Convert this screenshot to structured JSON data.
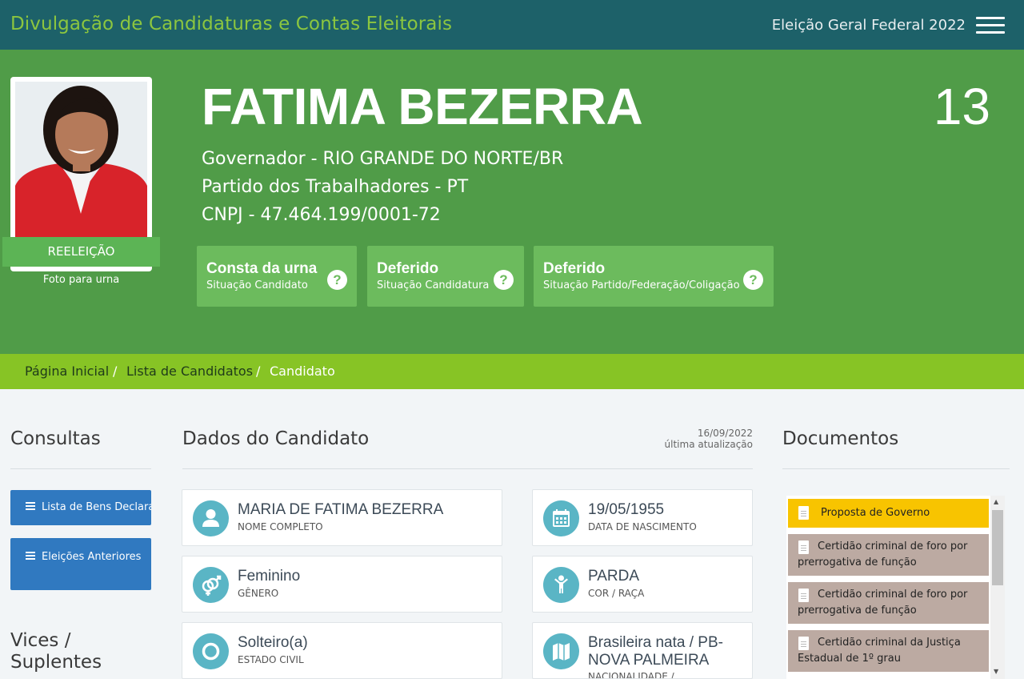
{
  "header": {
    "site_title": "Divulgação de Candidaturas e Contas Eleitorais",
    "election": "Eleição Geral Federal 2022"
  },
  "candidate": {
    "name": "FATIMA BEZERRA",
    "number": "13",
    "office_line": "Governador - RIO GRANDE DO NORTE/BR",
    "party_line": "Partido dos Trabalhadores - PT",
    "cnpj_line": "CNPJ - 47.464.199/0001-72",
    "badge": "REELEIÇÃO",
    "photo_caption": "Foto para urna"
  },
  "status": [
    {
      "main": "Consta da urna",
      "sub": "Situação Candidato"
    },
    {
      "main": "Deferido",
      "sub": "Situação Candidatura"
    },
    {
      "main": "Deferido",
      "sub": "Situação Partido/Federação/Coligação"
    }
  ],
  "breadcrumb": {
    "home": "Página Inicial",
    "list": "Lista de Candidatos",
    "current": "Candidato",
    "separator": "/"
  },
  "sidebar": {
    "title": "Consultas",
    "btn_bens": "Lista de Bens Declarados",
    "btn_eleicoes": "Eleições Anteriores",
    "vices_title": "Vices / Suplentes"
  },
  "dados": {
    "title": "Dados do Candidato",
    "update_date": "16/09/2022",
    "update_label": "última atualização",
    "fields": [
      {
        "value": "MARIA DE FATIMA BEZERRA",
        "label": "NOME COMPLETO"
      },
      {
        "value": "19/05/1955",
        "label": "DATA DE NASCIMENTO"
      },
      {
        "value": "Feminino",
        "label": "GÊNERO"
      },
      {
        "value": "PARDA",
        "label": "COR / RAÇA"
      },
      {
        "value": "Solteiro(a)",
        "label": "ESTADO CIVIL"
      },
      {
        "value": "Brasileira nata / PB-NOVA PALMEIRA",
        "label": "NACIONALIDADE /"
      }
    ]
  },
  "documentos": {
    "title": "Documentos",
    "items": [
      "Proposta de Governo",
      "Certidão criminal de foro por prerrogativa de função",
      "Certidão criminal de foro por prerrogativa de função",
      "Certidão criminal da Justiça Estadual de 1º grau"
    ]
  },
  "colors": {
    "topbar": "#1d6169",
    "hero": "#509c48",
    "breadcrumb": "#87c425",
    "button_blue": "#3079c0",
    "doc_highlight": "#f8c400",
    "icon_teal": "#5ab5c5"
  }
}
